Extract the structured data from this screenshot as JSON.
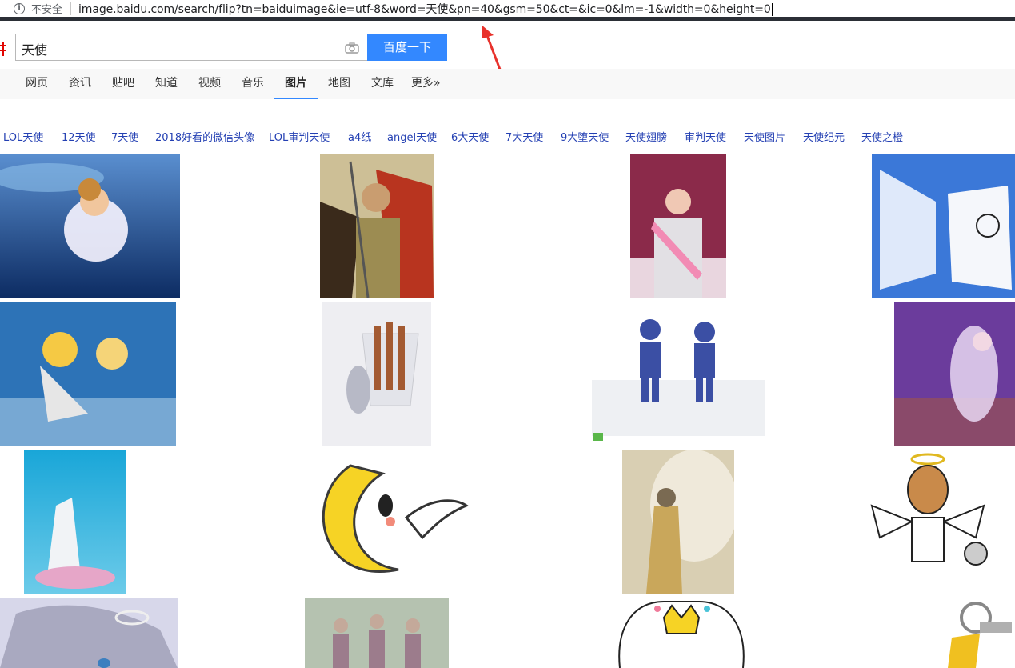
{
  "browser": {
    "security_label": "不安全",
    "url": "image.baidu.com/search/flip?tn=baiduimage&ie=utf-8&word=天使&pn=40&gsm=50&ct=&ic=0&lm=-1&width=0&height=0"
  },
  "search": {
    "query": "天使",
    "button_label": "百度一下"
  },
  "nav": {
    "tabs": [
      {
        "label": "网页"
      },
      {
        "label": "资讯"
      },
      {
        "label": "贴吧"
      },
      {
        "label": "知道"
      },
      {
        "label": "视频"
      },
      {
        "label": "音乐"
      },
      {
        "label": "图片",
        "active": true
      },
      {
        "label": "地图"
      },
      {
        "label": "文库"
      },
      {
        "label": "更多»"
      }
    ]
  },
  "related_searches": [
    "LOL天使",
    "12天使",
    "7天使",
    "2018好看的微信头像",
    "LOL审判天使",
    "a4纸",
    "angel天使",
    "6大天使",
    "7大天使",
    "9大堕天使",
    "天使翅膀",
    "审判天使",
    "天使图片",
    "天使纪元",
    "天使之橙"
  ],
  "colors": {
    "accent": "#3388ff",
    "link": "#2440b3",
    "annotation": "#e8322c"
  }
}
